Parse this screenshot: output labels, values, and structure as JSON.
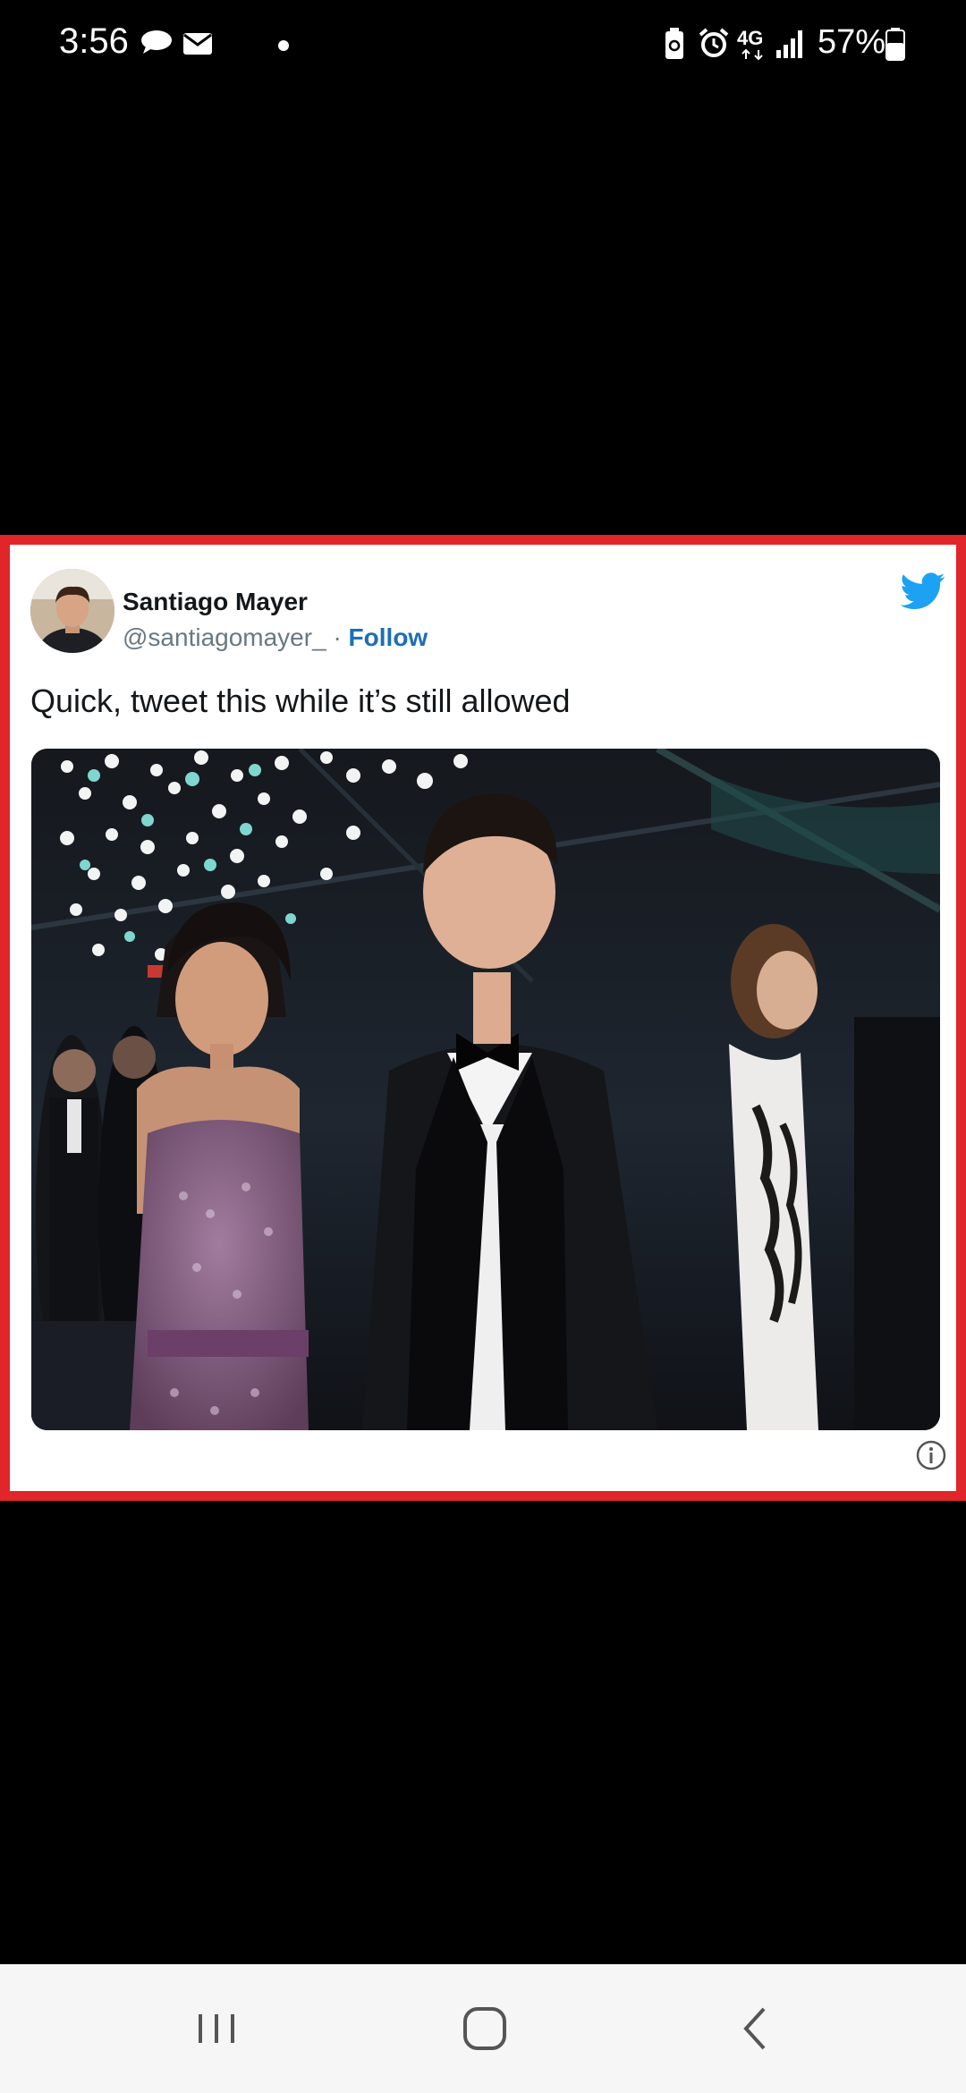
{
  "status_bar": {
    "time": "3:56",
    "battery_percent": "57%",
    "network": "4G",
    "icons": [
      "chat-bubble-icon",
      "mail-icon",
      "notification-dot-icon",
      "battery-saver-icon",
      "alarm-icon",
      "4g-icon",
      "signal-icon",
      "battery-icon"
    ]
  },
  "tweet": {
    "display_name": "Santiago Mayer",
    "handle": "@santiagomayer_",
    "separator": "·",
    "follow_label": "Follow",
    "text": "Quick, tweet this while it’s still allowed",
    "brand_color": "#1da1f2",
    "follow_color": "#1b6fb6",
    "frame_color": "#e0262a",
    "icons": [
      "twitter-bird-icon",
      "info-icon"
    ]
  },
  "nav_bar": {
    "buttons": [
      "recent-apps-icon",
      "home-icon",
      "back-icon"
    ]
  }
}
